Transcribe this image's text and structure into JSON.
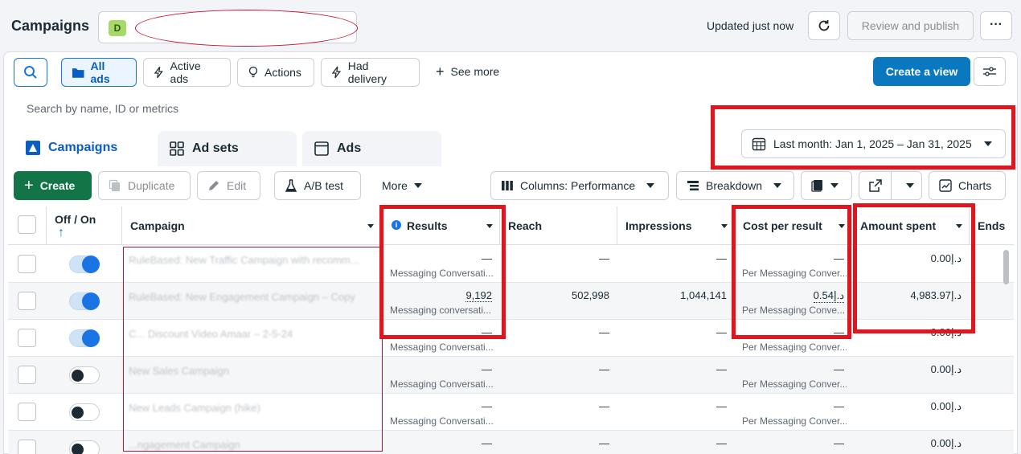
{
  "header": {
    "title": "Campaigns",
    "account_badge": "D",
    "updated": "Updated just now",
    "review_publish": "Review and publish",
    "more": "···"
  },
  "filters": {
    "all_ads": "All ads",
    "active_ads": "Active ads",
    "actions": "Actions",
    "had_delivery": "Had delivery",
    "see_more": "See more",
    "create_view": "Create a view"
  },
  "search": {
    "placeholder": "Search by name, ID or metrics"
  },
  "tabs": {
    "campaigns": "Campaigns",
    "ad_sets": "Ad sets",
    "ads": "Ads"
  },
  "date_range": "Last month: Jan 1, 2025 – Jan 31, 2025",
  "toolbar": {
    "create": "Create",
    "duplicate": "Duplicate",
    "edit": "Edit",
    "ab_test": "A/B test",
    "more": "More",
    "columns": "Columns: Performance",
    "breakdown": "Breakdown",
    "charts": "Charts"
  },
  "table": {
    "headers": {
      "off_on": "Off / On",
      "sort_arrow": "↑",
      "campaign": "Campaign",
      "results": "Results",
      "reach": "Reach",
      "impressions": "Impressions",
      "cost_per_result": "Cost per result",
      "amount_spent": "Amount spent",
      "ends": "Ends"
    },
    "rows": [
      {
        "on": true,
        "campaign": "RuleBased: New Traffic Campaign with recomm...",
        "results": "—",
        "results_sub": "Messaging Conversati...",
        "reach": "—",
        "impressions": "—",
        "cpr": "—",
        "cpr_sub": "Per Messaging Conver...",
        "spent": "0.00د.إ"
      },
      {
        "on": true,
        "campaign": "RuleBased: New Engagement Campaign – Copy",
        "results": "9,192",
        "results_sub": "Messaging conversati...",
        "reach": "502,998",
        "impressions": "1,044,141",
        "cpr": "0.54د.إ",
        "cpr_sub": "Per Messaging Conve...",
        "spent": "4,983.97د.إ"
      },
      {
        "on": true,
        "campaign": "C... Discount Video Amaar – 2-5-24",
        "results": "—",
        "results_sub": "Messaging Conversati...",
        "reach": "—",
        "impressions": "—",
        "cpr": "—",
        "cpr_sub": "Per Messaging Conver...",
        "spent": "0.00د.إ"
      },
      {
        "on": false,
        "campaign": "New Sales Campaign",
        "results": "—",
        "results_sub": "Messaging Conversati...",
        "reach": "—",
        "impressions": "—",
        "cpr": "—",
        "cpr_sub": "Per Messaging Conver...",
        "spent": "0.00د.إ"
      },
      {
        "on": false,
        "campaign": "New Leads Campaign (hike)",
        "results": "—",
        "results_sub": "Messaging Conversati...",
        "reach": "—",
        "impressions": "—",
        "cpr": "—",
        "cpr_sub": "Per Messaging Conver...",
        "spent": "0.00د.إ"
      },
      {
        "on": false,
        "campaign": "...ngagement Campaign",
        "results": "—",
        "results_sub": "",
        "reach": "—",
        "impressions": "—",
        "cpr": "—",
        "cpr_sub": "",
        "spent": "0.00د.إ"
      }
    ]
  },
  "colors": {
    "accent": "#1b74e4",
    "create_green": "#137547",
    "annotation_red": "#e0161e"
  }
}
